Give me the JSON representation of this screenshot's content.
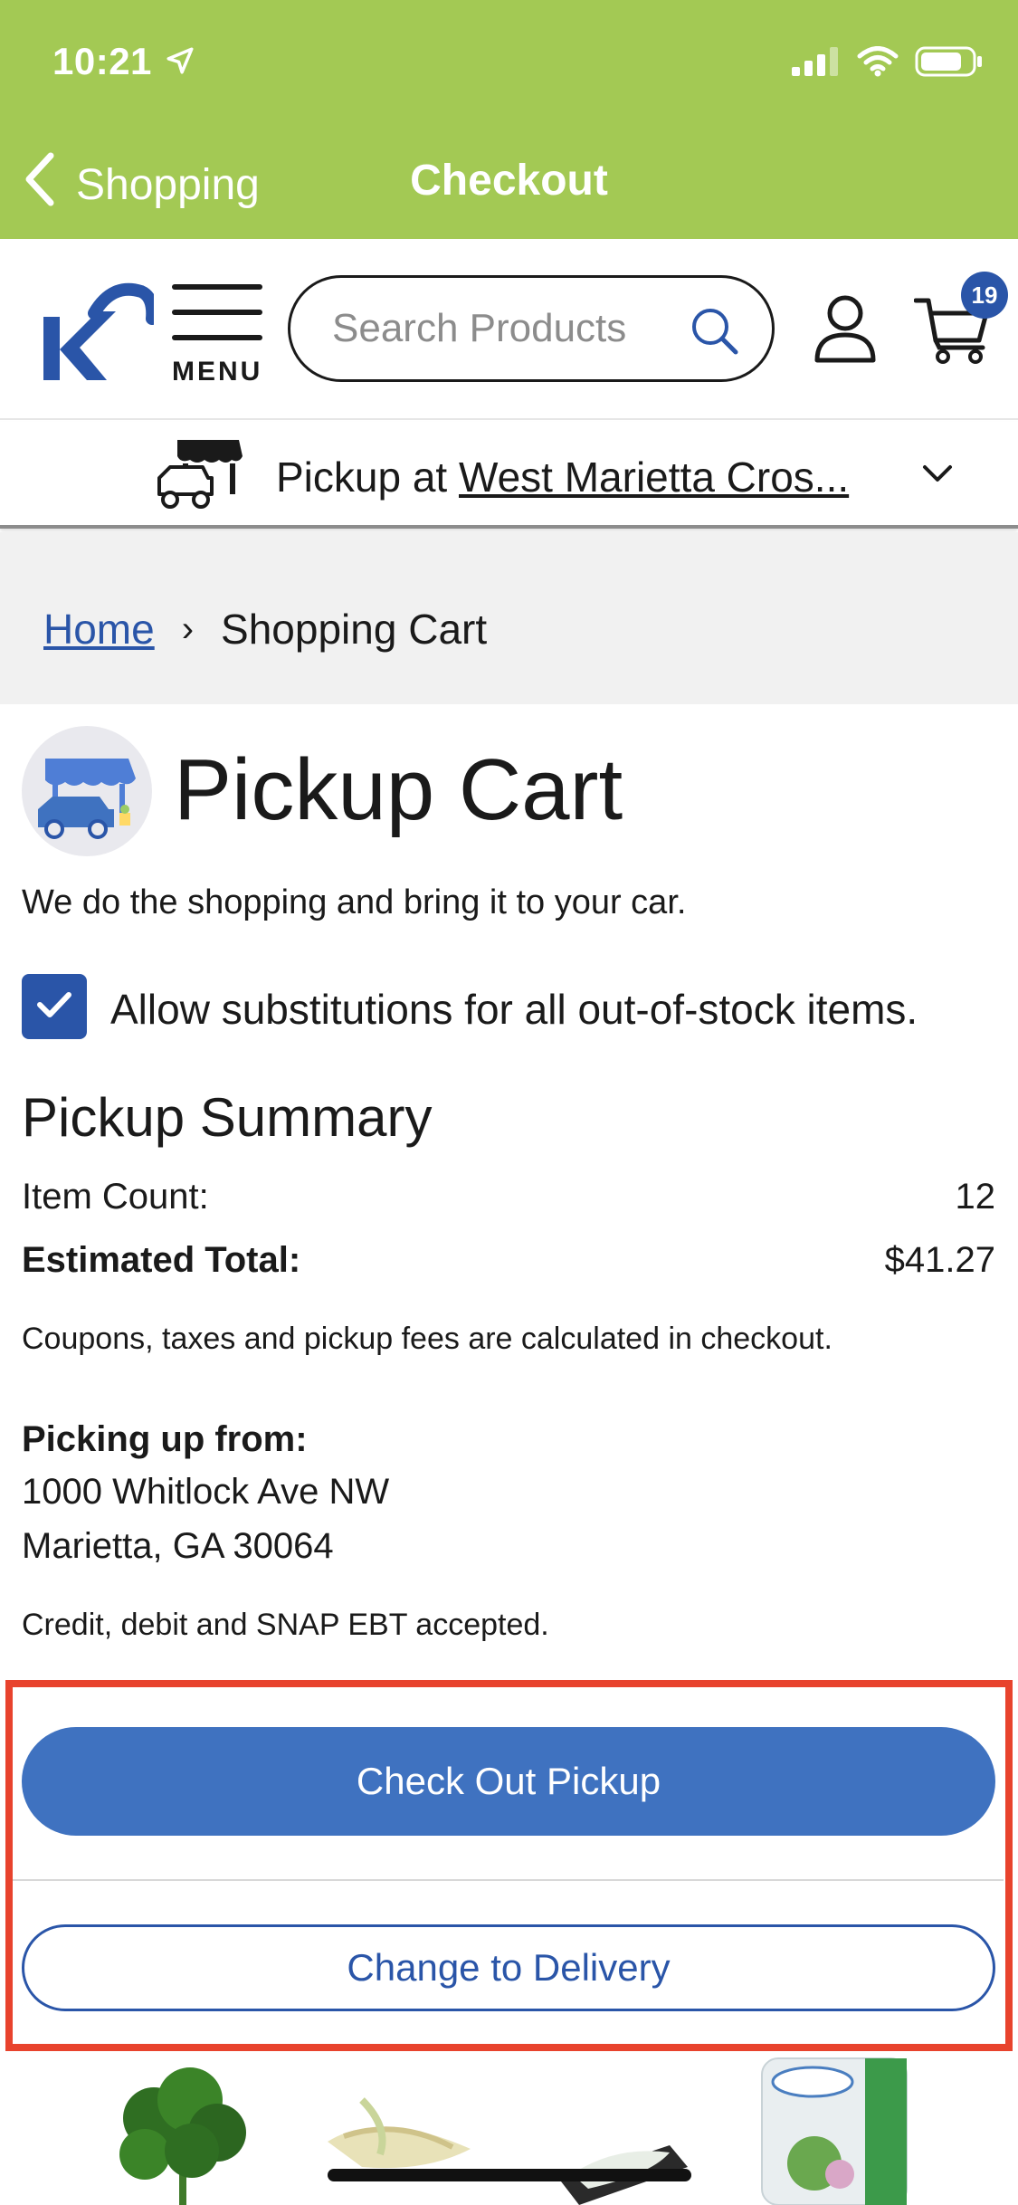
{
  "status_bar": {
    "time": "10:21"
  },
  "nav": {
    "back_label": "Shopping",
    "title": "Checkout"
  },
  "header": {
    "menu_label": "MENU",
    "search_placeholder": "Search Products",
    "cart_count": "19"
  },
  "pickup_bar": {
    "prefix": "Pickup at ",
    "store": "West Marietta Cros..."
  },
  "breadcrumb": {
    "home": "Home",
    "separator": "›",
    "current": "Shopping Cart"
  },
  "cart": {
    "title": "Pickup Cart",
    "subtitle": "We do the shopping and bring it to your car.",
    "substitutions_label": "Allow substitutions for all out-of-stock items.",
    "substitutions_checked": true
  },
  "summary": {
    "title": "Pickup Summary",
    "item_count_label": "Item Count:",
    "item_count": "12",
    "estimated_total_label": "Estimated Total:",
    "estimated_total": "$41.27",
    "note": "Coupons, taxes and pickup fees are calculated in checkout.",
    "picking_up_label": "Picking up from:",
    "address_line1": "1000 Whitlock Ave NW",
    "address_line2": "Marietta, GA 30064",
    "payment_note": "Credit, debit and SNAP EBT accepted."
  },
  "actions": {
    "checkout": "Check Out Pickup",
    "change": "Change to Delivery"
  },
  "colors": {
    "nav_green": "#a3c954",
    "brand_blue": "#2a55a8",
    "button_blue": "#3f72c0",
    "highlight_red": "#e8432d"
  },
  "icons": [
    "location-arrow-icon",
    "signal-icon",
    "wifi-icon",
    "battery-icon",
    "back-chevron-icon",
    "kroger-logo",
    "menu-icon",
    "search-icon",
    "account-icon",
    "cart-icon",
    "pickup-truck-icon",
    "chevron-down-icon",
    "checkmark-icon"
  ],
  "products": [
    "parsley",
    "corn",
    "cheese",
    "alouette spread"
  ]
}
